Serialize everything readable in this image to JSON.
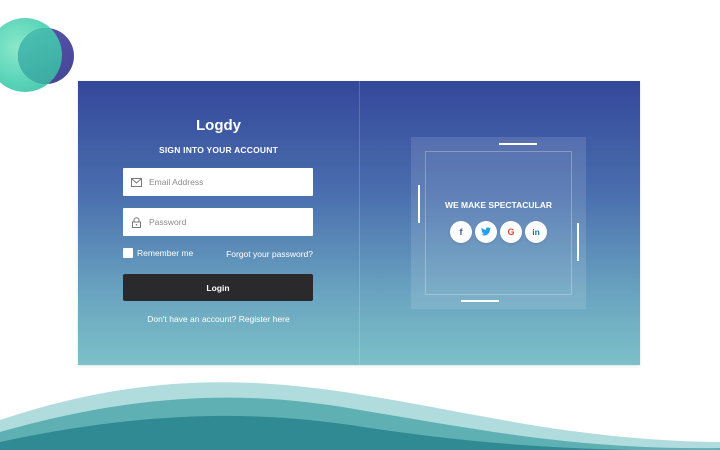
{
  "brand": "Logdy",
  "subtitle": "SIGN INTO YOUR ACCOUNT",
  "email": {
    "placeholder": "Email Address",
    "value": ""
  },
  "password": {
    "placeholder": "Password",
    "value": ""
  },
  "remember_label": "Remember me",
  "forgot_label": "Forgot your password?",
  "login_label": "Login",
  "register_text": "Don't have an account? Register here",
  "tagline": "WE MAKE SPECTACULAR",
  "social": [
    {
      "name": "facebook-icon",
      "glyph": "f",
      "color": "#3b5998"
    },
    {
      "name": "twitter-icon",
      "glyph": "🐦",
      "color": "#1da1f2"
    },
    {
      "name": "google-icon",
      "glyph": "G",
      "color": "#db4437"
    },
    {
      "name": "linkedin-icon",
      "glyph": "in",
      "color": "#0e76a8"
    }
  ],
  "colors": {
    "card_top": "#34479a",
    "card_bottom": "#7cc0c8",
    "button": "#2a2a2d",
    "wave": "#3a8f96"
  }
}
